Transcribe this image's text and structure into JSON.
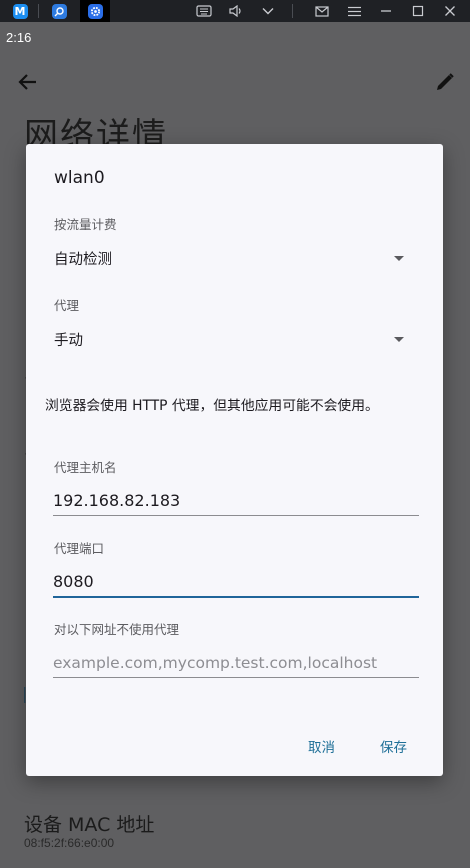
{
  "status_bar": {
    "time": "2:16"
  },
  "background_screen": {
    "title": "网络详情",
    "mac_label": "设备 MAC 地址",
    "mac_value": "08:f5:2f:66:e0:00"
  },
  "dialog": {
    "title": "wlan0",
    "metered": {
      "label": "按流量计费",
      "value": "自动检测"
    },
    "proxy": {
      "label": "代理",
      "value": "手动"
    },
    "hint": "浏览器会使用 HTTP 代理，但其他应用可能不会使用。",
    "hostname": {
      "label": "代理主机名",
      "value": "192.168.82.183"
    },
    "port": {
      "label": "代理端口",
      "value": "8080"
    },
    "bypass": {
      "label": "对以下网址不使用代理",
      "placeholder": "example.com,mycomp.test.com,localhost"
    },
    "cancel_label": "取消",
    "save_label": "保存"
  },
  "colors": {
    "accent": "#1e6f97",
    "focus_underline": "#20659a",
    "dialog_bg": "#f7f7fb",
    "scrim": "#5f5f61"
  },
  "icons": [
    "back-arrow-icon",
    "edit-pencil-icon",
    "dropdown-caret-icon"
  ]
}
